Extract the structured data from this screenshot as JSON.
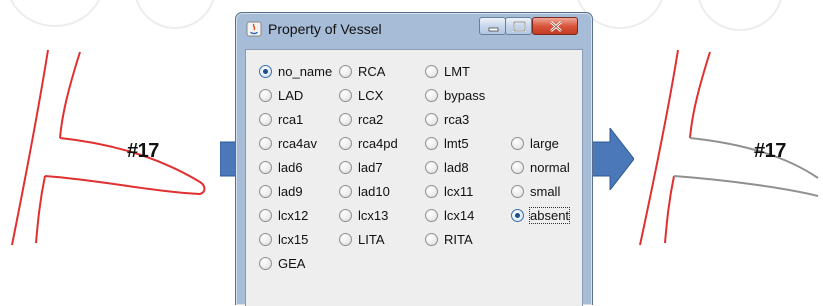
{
  "window": {
    "title": "Property of Vessel",
    "controls": [
      "minimize-icon",
      "maximize-icon",
      "close-icon"
    ]
  },
  "left_figure": {
    "label": "#17",
    "color": "#e03030"
  },
  "right_figure": {
    "label": "#17",
    "color": "#909090"
  },
  "arrow_color": "#4a78b8",
  "radio_grid": {
    "col1": [
      "no_name",
      "LAD",
      "rca1",
      "rca4av",
      "lad6",
      "lad9",
      "lcx12",
      "lcx15",
      "GEA"
    ],
    "col2": [
      "RCA",
      "LCX",
      "rca2",
      "rca4pd",
      "lad7",
      "lad10",
      "lcx13",
      "LITA"
    ],
    "col3": [
      "LMT",
      "bypass",
      "rca3",
      "lmt5",
      "lad8",
      "lcx11",
      "lcx14",
      "RITA"
    ],
    "col4": [
      "large",
      "normal",
      "small",
      "absent"
    ]
  },
  "selected": [
    "no_name",
    "absent"
  ]
}
